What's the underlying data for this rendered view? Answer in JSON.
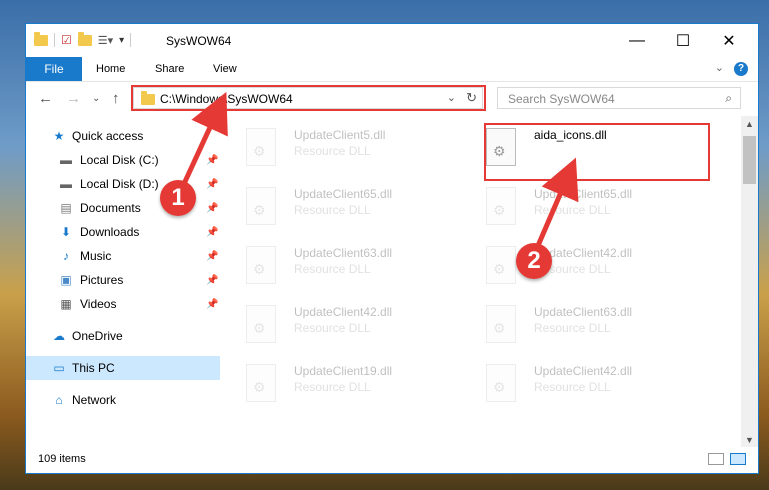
{
  "window": {
    "title": "SysWOW64"
  },
  "ribbon": {
    "file": "File",
    "tabs": [
      "Home",
      "Share",
      "View"
    ]
  },
  "address": {
    "path": "C:\\Windows\\SysWOW64"
  },
  "search": {
    "placeholder": "Search SysWOW64"
  },
  "sidebar": {
    "items": [
      {
        "label": "Quick access"
      },
      {
        "label": "Local Disk (C:)"
      },
      {
        "label": "Local Disk (D:)"
      },
      {
        "label": "Documents"
      },
      {
        "label": "Downloads"
      },
      {
        "label": "Music"
      },
      {
        "label": "Pictures"
      },
      {
        "label": "Videos"
      },
      {
        "label": "OneDrive"
      },
      {
        "label": "This PC"
      },
      {
        "label": "Network"
      }
    ]
  },
  "files": {
    "left": [
      {
        "name": "UpdateClient5.dll",
        "type": "Resource DLL"
      },
      {
        "name": "UpdateClient65.dll",
        "type": "Resource DLL"
      },
      {
        "name": "UpdateClient63.dll",
        "type": "Resource DLL"
      },
      {
        "name": "UpdateClient42.dll",
        "type": "Resource DLL"
      },
      {
        "name": "UpdateClient19.dll",
        "type": "Resource DLL"
      }
    ],
    "right": [
      {
        "name": "aida_icons.dll",
        "type": ""
      },
      {
        "name": "UpdateClient65.dll",
        "type": "Resource DLL"
      },
      {
        "name": "UpdateClient42.dll",
        "type": "Resource DLL"
      },
      {
        "name": "UpdateClient63.dll",
        "type": "Resource DLL"
      },
      {
        "name": "UpdateClient42.dll",
        "type": "Resource DLL"
      }
    ]
  },
  "status": {
    "count": "109 items"
  },
  "annotations": {
    "step1": "1",
    "step2": "2"
  },
  "colors": {
    "accent": "#1979ca",
    "highlight": "#e53935"
  }
}
